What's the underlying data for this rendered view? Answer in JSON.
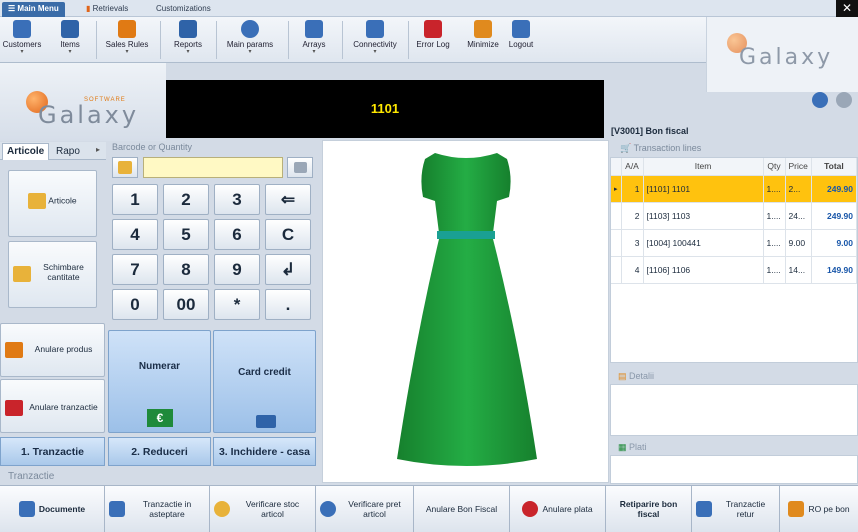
{
  "ribbon_tabs": [
    "Main Menu",
    "Retrievals",
    "Customizations"
  ],
  "toolbar": [
    {
      "label": "Customers",
      "icon": "customers-icon",
      "color": "#3a6fb8"
    },
    {
      "label": "Items",
      "icon": "items-icon",
      "color": "#2f63a8"
    },
    {
      "label": "Sales Rules",
      "icon": "cart-icon",
      "color": "#e07a14"
    },
    {
      "label": "Reports",
      "icon": "reports-icon",
      "color": "#2f63a8"
    },
    {
      "label": "Main params",
      "icon": "gear-icon",
      "color": "#3a6fb8"
    },
    {
      "label": "Arrays",
      "icon": "arrays-icon",
      "color": "#3a6fb8"
    },
    {
      "label": "Connectivity",
      "icon": "connectivity-icon",
      "color": "#3a6fb8"
    },
    {
      "label": "Error Log",
      "icon": "error-log-icon",
      "color": "#c9242b"
    },
    {
      "label": "Minimize",
      "icon": "minimize-icon",
      "color": "#e08a1e"
    },
    {
      "label": "Logout",
      "icon": "logout-icon",
      "color": "#3a6fb8"
    }
  ],
  "logo": {
    "brand": "Galaxy",
    "tagline": "SOFTWARE"
  },
  "display": {
    "value": "1101"
  },
  "left_tabs": [
    "Articole",
    "Rapo"
  ],
  "barcode": {
    "label": "Barcode or Quantity",
    "value": ""
  },
  "side_buttons": [
    "Articole",
    "Schimbare cantitate",
    "Anulare produs",
    "Anulare tranzactie"
  ],
  "keypad": [
    "1",
    "2",
    "3",
    "⇐",
    "4",
    "5",
    "6",
    "C",
    "7",
    "8",
    "9",
    "↲",
    "0",
    "00",
    "*",
    "."
  ],
  "payments": {
    "cash": "Numerar",
    "card": "Card credit"
  },
  "steps": [
    "1. Tranzactie",
    "2. Reduceri",
    "3. Inchidere - casa"
  ],
  "section_label": "Tranzactie",
  "receipt": {
    "title": "[V3001] Bon fiscal",
    "lines_label": "Transaction lines",
    "columns": [
      "A/A",
      "Item",
      "Qty",
      "Price",
      "Total"
    ],
    "rows": [
      {
        "aa": "1",
        "item": "[1101] 1101",
        "qty": "1....",
        "price": "2...",
        "total": "249.90"
      },
      {
        "aa": "2",
        "item": "[1103] 1103",
        "qty": "1....",
        "price": "24...",
        "total": "249.90"
      },
      {
        "aa": "3",
        "item": "[1004] 100441",
        "qty": "1....",
        "price": "9.00",
        "total": "9.00"
      },
      {
        "aa": "4",
        "item": "[1106] 1106",
        "qty": "1....",
        "price": "14...",
        "total": "149.90"
      }
    ],
    "details_label": "Detalii",
    "payments_label": "Plati"
  },
  "bottom_buttons": [
    "Documente",
    "Tranzactie in asteptare",
    "Verificare stoc articol",
    "Verificare pret articol",
    "Anulare Bon Fiscal",
    "Anulare plata",
    "Retiparire bon fiscal",
    "Tranzactie retur",
    "RO pe bon"
  ],
  "product_image": {
    "subject": "green dress",
    "color": "#1e9b3a"
  }
}
